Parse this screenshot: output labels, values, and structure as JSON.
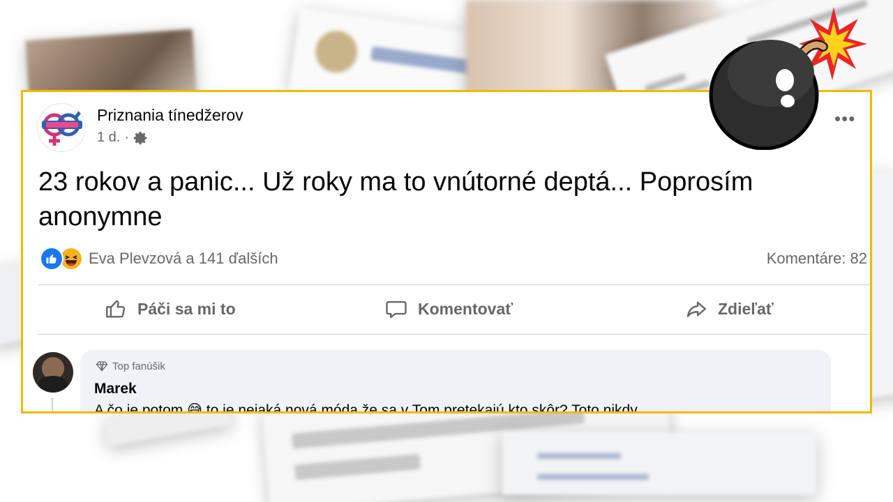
{
  "post": {
    "page_name": "Priznania tínedžerov",
    "time": "1 d.",
    "separator": "·",
    "text": "23 rokov a panic... Už roky ma to vnútorné deptá... Poprosím anonymne",
    "reactions_text": "Eva Plevzová a 141 ďalších",
    "comments_count": "Komentáre: 82"
  },
  "actions": {
    "like": "Páči sa mi to",
    "comment": "Komentovať",
    "share": "Zdieľať"
  },
  "comment": {
    "badge": "Top fanúšik",
    "author": "Marek",
    "text": "A čo je potom 😅 to je nejaká nová móda že sa v Tom pretekajú kto skôr? Toto nikdy"
  },
  "colors": {
    "highlight_border": "#f5b900",
    "like_blue": "#1877f2",
    "secondary_text": "#65676b"
  }
}
